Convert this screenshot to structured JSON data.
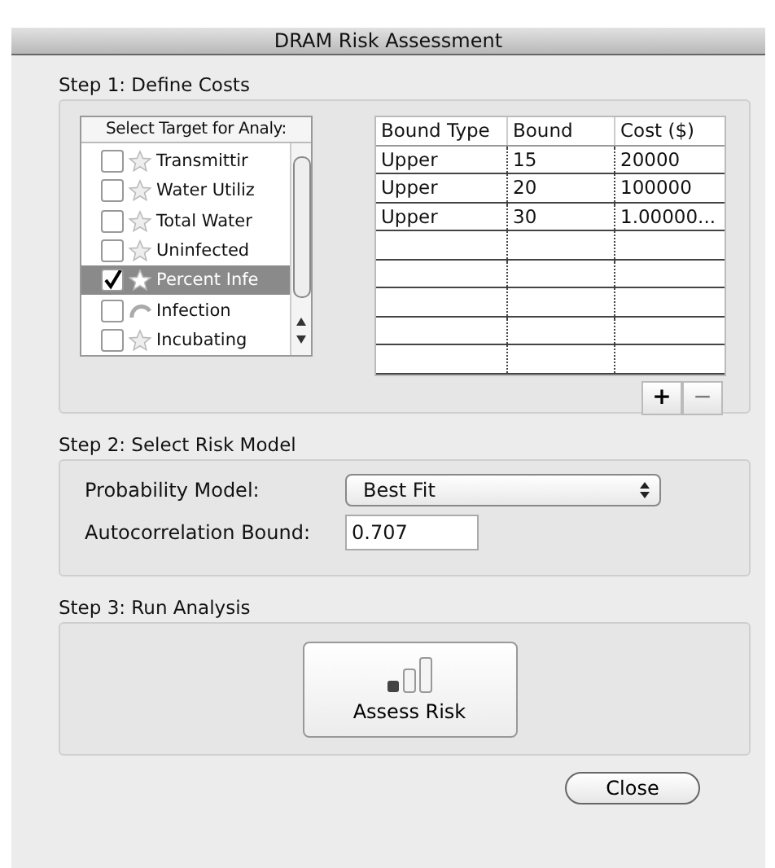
{
  "window": {
    "title": "DRAM Risk Assessment"
  },
  "step1": {
    "label": "Step 1: Define Costs",
    "target_list": {
      "header": "Select Target for Analy:",
      "items": [
        {
          "label": "Transmittir",
          "kind": "star",
          "checked": false,
          "selected": false
        },
        {
          "label": "Water Utiliz",
          "kind": "star",
          "checked": false,
          "selected": false
        },
        {
          "label": "Total Water",
          "kind": "star",
          "checked": false,
          "selected": false
        },
        {
          "label": "Uninfected",
          "kind": "star",
          "checked": false,
          "selected": false
        },
        {
          "label": "Percent Infe",
          "kind": "star",
          "checked": true,
          "selected": true
        },
        {
          "label": "Infection",
          "kind": "arc",
          "checked": false,
          "selected": false
        },
        {
          "label": "Incubating",
          "kind": "star",
          "checked": false,
          "selected": false
        }
      ]
    },
    "table": {
      "columns": [
        "Bound Type",
        "Bound",
        "Cost ($)"
      ],
      "rows": [
        [
          "Upper",
          "15",
          "20000"
        ],
        [
          "Upper",
          "20",
          "100000"
        ],
        [
          "Upper",
          "30",
          "1.00000..."
        ],
        [
          "",
          "",
          ""
        ],
        [
          "",
          "",
          ""
        ],
        [
          "",
          "",
          ""
        ],
        [
          "",
          "",
          ""
        ],
        [
          "",
          "",
          ""
        ]
      ]
    },
    "add_button": "+",
    "remove_button": "−"
  },
  "step2": {
    "label": "Step 2: Select Risk Model",
    "probability_model": {
      "label": "Probability Model:",
      "value": "Best Fit"
    },
    "autocorrelation_bound": {
      "label": "Autocorrelation Bound:",
      "value": "0.707"
    }
  },
  "step3": {
    "label": "Step 3: Run Analysis",
    "button": "Assess Risk"
  },
  "close_button": "Close"
}
